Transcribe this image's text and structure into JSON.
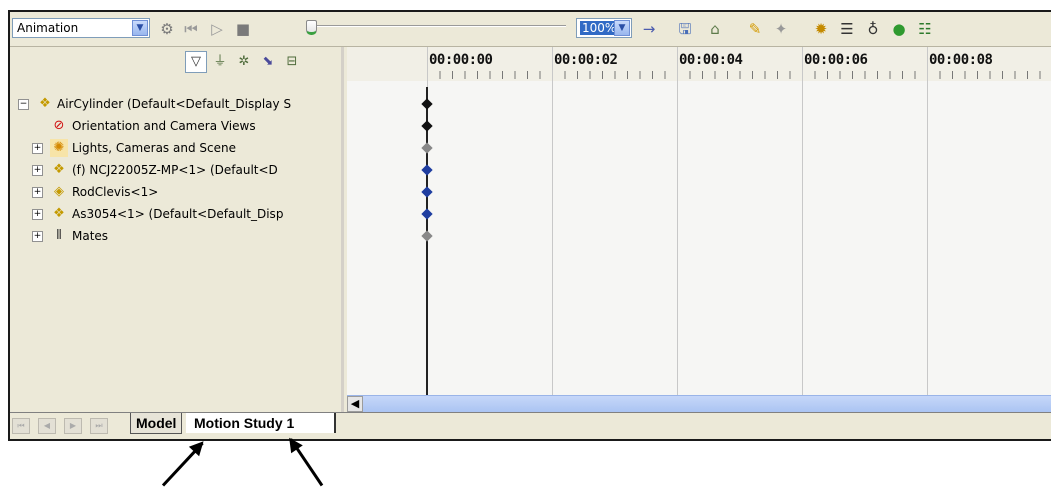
{
  "toolbar": {
    "study_type": "Animation",
    "zoom": "100%",
    "icons": [
      "calculate-icon",
      "play-from-start-icon",
      "play-icon",
      "stop-icon",
      "arrow-icon",
      "save-animation-icon",
      "animation-wizard-icon",
      "autokey-icon",
      "add-key-icon",
      "motor-icon",
      "spring-icon",
      "damper-icon",
      "contact-icon",
      "properties-icon"
    ]
  },
  "filter_icons": [
    "filter-animated-icon",
    "filter-driving-icon",
    "filter-selected-icon",
    "filter-results-icon",
    "filter-all-icon"
  ],
  "tree": {
    "items": [
      {
        "label": "AirCylinder  (Default<Default_Display S",
        "icon": "assembly-icon",
        "expander": "−"
      },
      {
        "label": "Orientation and Camera Views",
        "icon": "orientation-icon",
        "expander": ""
      },
      {
        "label": "Lights, Cameras and Scene",
        "icon": "lights-icon",
        "expander": "+"
      },
      {
        "label": "(f) NCJ22005Z-MP<1> (Default<D",
        "icon": "assembly-icon",
        "expander": "+"
      },
      {
        "label": "RodClevis<1>",
        "icon": "part-icon",
        "expander": "+"
      },
      {
        "label": "As3054<1> (Default<Default_Disp",
        "icon": "assembly-icon",
        "expander": "+"
      },
      {
        "label": "Mates",
        "icon": "mates-icon",
        "expander": "+"
      }
    ]
  },
  "timeline": {
    "ticks": [
      "00:00:00",
      "00:00:02",
      "00:00:04",
      "00:00:06",
      "00:00:08"
    ],
    "key_colors": [
      "#111111",
      "#111111",
      "#888888",
      "#1f3ea0",
      "#1f3ea0",
      "#1f3ea0",
      "#888888"
    ]
  },
  "tabs": {
    "model": "Model",
    "motion_study": "Motion Study 1"
  },
  "colors": {
    "panel_bg": "#ece9d8",
    "timeline_bg": "#f6f6f4",
    "scrollbar": "#a9c3f2",
    "selection": "#316ac5"
  }
}
